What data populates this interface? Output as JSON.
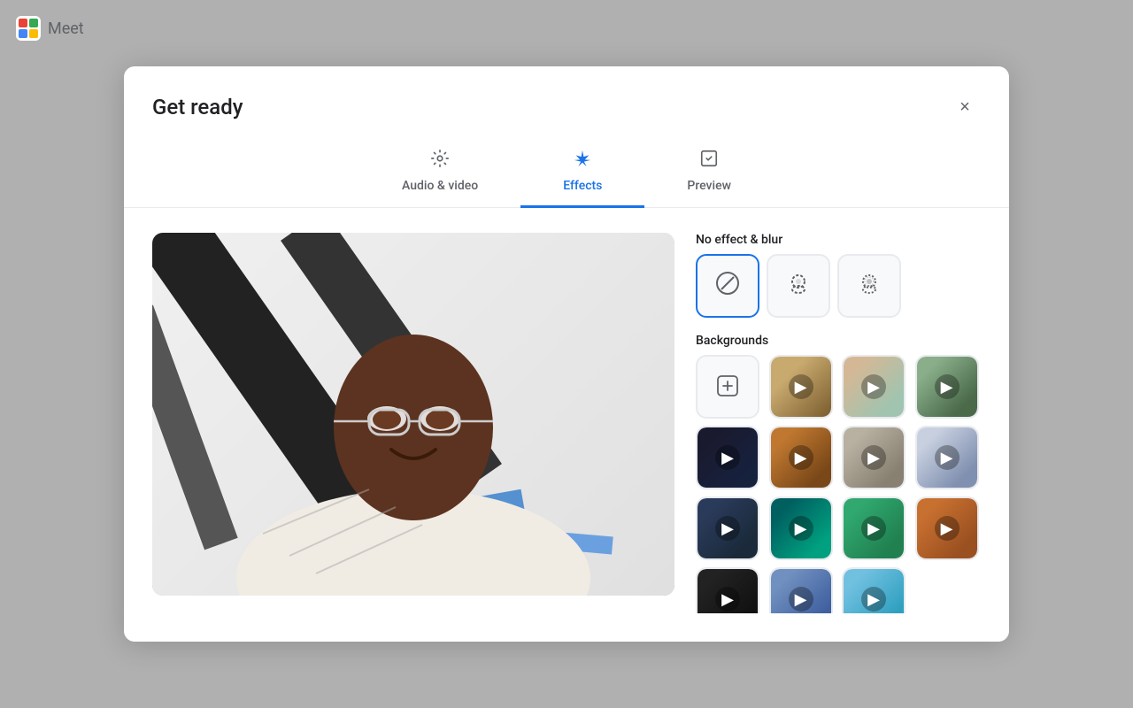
{
  "app": {
    "name": "Meet",
    "logo_alt": "Google Meet logo"
  },
  "modal": {
    "title": "Get ready",
    "close_label": "×"
  },
  "tabs": [
    {
      "id": "audio-video",
      "label": "Audio & video",
      "icon": "⚙️",
      "active": false
    },
    {
      "id": "effects",
      "label": "Effects",
      "icon": "✦",
      "active": true
    },
    {
      "id": "preview",
      "label": "Preview",
      "icon": "📋",
      "active": false
    }
  ],
  "effects": {
    "no_effect_section_title": "No effect & blur",
    "backgrounds_section_title": "Backgrounds",
    "no_effect_options": [
      {
        "id": "no-effect",
        "label": "No effect",
        "selected": true
      },
      {
        "id": "blur-slight",
        "label": "Slight blur",
        "selected": false
      },
      {
        "id": "blur-strong",
        "label": "Strong blur",
        "selected": false
      }
    ],
    "upload_label": "Upload background",
    "backgrounds": [
      {
        "id": "bg1",
        "label": "Background 1",
        "color_class": "bg1"
      },
      {
        "id": "bg2",
        "label": "Background 2",
        "color_class": "bg2"
      },
      {
        "id": "bg3",
        "label": "Background 3",
        "color_class": "bg3"
      },
      {
        "id": "bg4",
        "label": "Background 4",
        "color_class": "bg4"
      },
      {
        "id": "bg5",
        "label": "Background 5",
        "color_class": "bg5"
      },
      {
        "id": "bg6",
        "label": "Background 6",
        "color_class": "bg6"
      },
      {
        "id": "bg7",
        "label": "Background 7",
        "color_class": "bg7"
      },
      {
        "id": "bg8",
        "label": "Background 8",
        "color_class": "bg8"
      },
      {
        "id": "bg9",
        "label": "Background 9",
        "color_class": "bg9"
      },
      {
        "id": "bg10",
        "label": "Background 10",
        "color_class": "bg10"
      },
      {
        "id": "bg11",
        "label": "Background 11",
        "color_class": "bg11"
      },
      {
        "id": "bg12",
        "label": "Background 12",
        "color_class": "bg12"
      },
      {
        "id": "bg13",
        "label": "Background 13",
        "color_class": "bg13"
      },
      {
        "id": "bg14",
        "label": "Background 14",
        "color_class": "bg14"
      }
    ]
  },
  "colors": {
    "active_tab": "#1a73e8",
    "inactive_tab": "#5f6368",
    "selected_border": "#1a73e8"
  }
}
